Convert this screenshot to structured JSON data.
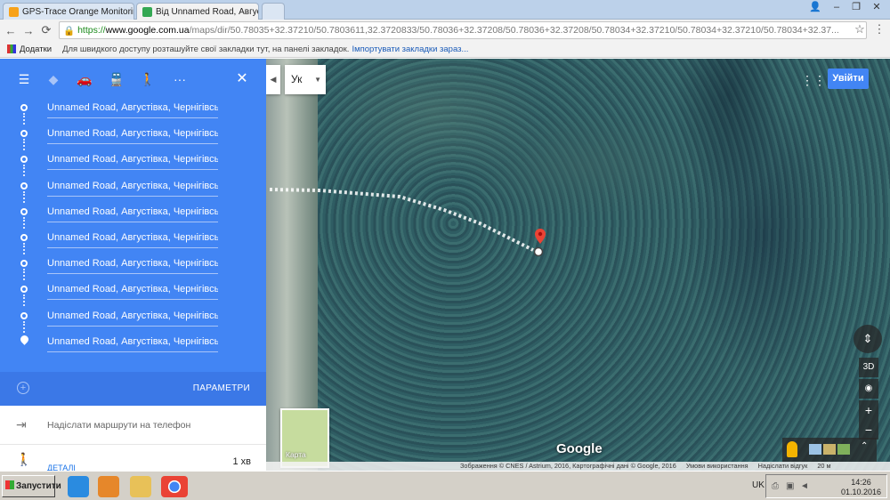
{
  "browser": {
    "tabs": [
      {
        "title": "GPS-Trace Orange Monitoring",
        "favicon_color": "#f7a21b"
      },
      {
        "title": "Від Unnamed Road, Августівка,",
        "favicon_color": "#34a853"
      }
    ],
    "url": {
      "scheme": "https://",
      "host": "www.google.com.ua",
      "path": "/maps/dir/50.78035+32.37210/50.7803611,32.3720833/50.78036+32.37208/50.78036+32.37208/50.78034+32.37210/50.78034+32.37210/50.78034+32.37..."
    },
    "bookmarks": {
      "apps_label": "Додатки",
      "hint": "Для швидкого доступу розташуйте свої закладки тут, на панелі закладок.",
      "import_link": "Імпортувати закладки зараз..."
    }
  },
  "directions": {
    "modes": [
      "menu-icon",
      "best-route-icon",
      "car-icon",
      "transit-icon",
      "walk-icon",
      "more-icon"
    ],
    "close_icon": "close-icon",
    "waypoints": [
      "Unnamed Road, Августівка, Чернігівська",
      "Unnamed Road, Августівка, Чернігівська",
      "Unnamed Road, Августівка, Чернігівська",
      "Unnamed Road, Августівка, Чернігівська",
      "Unnamed Road, Августівка, Чернігівська",
      "Unnamed Road, Августівка, Чернігівська",
      "Unnamed Road, Августівка, Чернігівська",
      "Unnamed Road, Августівка, Чернігівська",
      "Unnamed Road, Августівка, Чернігівська",
      "Unnamed Road, Августівка, Чернігівська"
    ],
    "options_label": "ПАРАМЕТРИ",
    "send_label": "Надіслати маршрути на телефон",
    "route": {
      "details_label": "ДЕТАЛІ",
      "time": "1 хв"
    }
  },
  "map": {
    "lang_select": "Ук",
    "signin_label": "Увійти",
    "minimap_label": "Карта",
    "logo": "Google",
    "tilt_label": "3D",
    "zoom_in": "+",
    "zoom_out": "−",
    "attribution": [
      "Зображення © CNES / Astrium, 2016, Картографічні дані © Google, 2016",
      "Умови використання",
      "Надіслати відгук",
      "20 м"
    ],
    "colors": {
      "accent": "#4285f4",
      "marker": "#ea4335"
    }
  },
  "taskbar": {
    "start_label": "Запустити",
    "apps": [
      "ie-icon",
      "media-player-icon",
      "explorer-icon",
      "chrome-icon"
    ],
    "language": "UK",
    "time": "14:26",
    "date": "01.10.2016"
  }
}
